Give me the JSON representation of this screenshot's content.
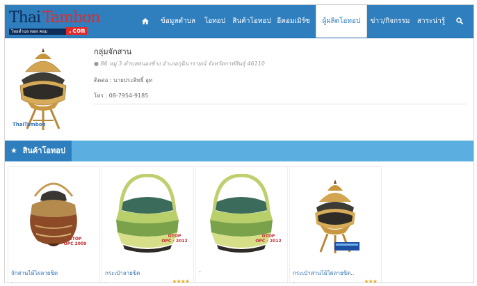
{
  "brand": {
    "name_part1": "Thai",
    "name_part2": "Tambon",
    "tagline": "ไทยตำบล ดอท คอม",
    "domain_suffix": ".com",
    "watermark": "ThaiTambon"
  },
  "nav": {
    "home_icon": "home-icon",
    "items": [
      {
        "label": "ข้อมูลตำบล"
      },
      {
        "label": "โอทอป"
      },
      {
        "label": "สินค้าโอทอป"
      },
      {
        "label": "อีคอมเมิร์ซ"
      },
      {
        "label": "ผู้ผลิตโอทอป",
        "active": true
      },
      {
        "label": "ข่าว/กิจกรรม"
      },
      {
        "label": "สาระน่ารู้"
      }
    ],
    "search_icon": "search-icon",
    "accent_color": "#2f7fbf"
  },
  "profile": {
    "name": "กลุ่มจักสาน",
    "address": "86 หมู่ 3 ตำบลหนองช้าง อำเภอกุฉินารายณ์ จังหวัดกาฬสินธุ์ 46110",
    "contact": "ติดต่อ : นายประสิทธิ์ อุท",
    "phone": "โทร : 08-7954-9185"
  },
  "section": {
    "title": "สินค้าโอทอป",
    "icon": "star-icon"
  },
  "products": [
    {
      "name": "จักสานไม้ไผ่ลายขิด",
      "stars": "",
      "meta": "-",
      "badge": "OTOP\nOPC 2009"
    },
    {
      "name": "กระเป๋าลายขิด",
      "stars": "★★★★",
      "meta": "-",
      "badge": "OTOP\nOPC - 2012"
    },
    {
      "name": "-",
      "stars": "",
      "meta": "",
      "badge": "OTOP\nOPC - 2012"
    },
    {
      "name": "กระเป๋าสานไม้ไผ่ลายขิด..",
      "stars": "★★★",
      "meta": "-",
      "badge": ""
    }
  ]
}
